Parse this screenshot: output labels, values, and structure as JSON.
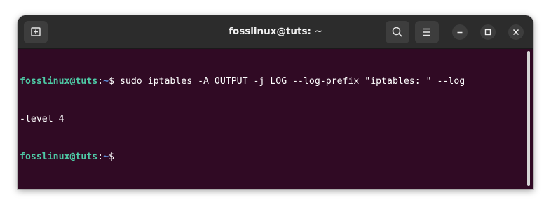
{
  "window": {
    "title": "fosslinux@tuts: ~"
  },
  "titlebar": {
    "new_tab_icon": "new-tab-icon",
    "search_icon": "search-icon",
    "menu_icon": "hamburger-menu-icon",
    "minimize_icon": "minimize-icon",
    "maximize_icon": "maximize-icon",
    "close_icon": "close-icon"
  },
  "terminal": {
    "lines": [
      {
        "user": "fosslinux@tuts",
        "sep": ":",
        "path": "~",
        "symbol": "$",
        "command": " sudo iptables -A OUTPUT -j LOG --log-prefix \"iptables: \" --log"
      },
      {
        "text": "-level 4"
      },
      {
        "user": "fosslinux@tuts",
        "sep": ":",
        "path": "~",
        "symbol": "$",
        "command": ""
      }
    ]
  },
  "colors": {
    "terminal_bg": "#300a24",
    "titlebar_bg": "#2c2c2c",
    "prompt_user": "#4ec9a5",
    "prompt_path": "#5f8fd8",
    "text": "#ffffff"
  }
}
